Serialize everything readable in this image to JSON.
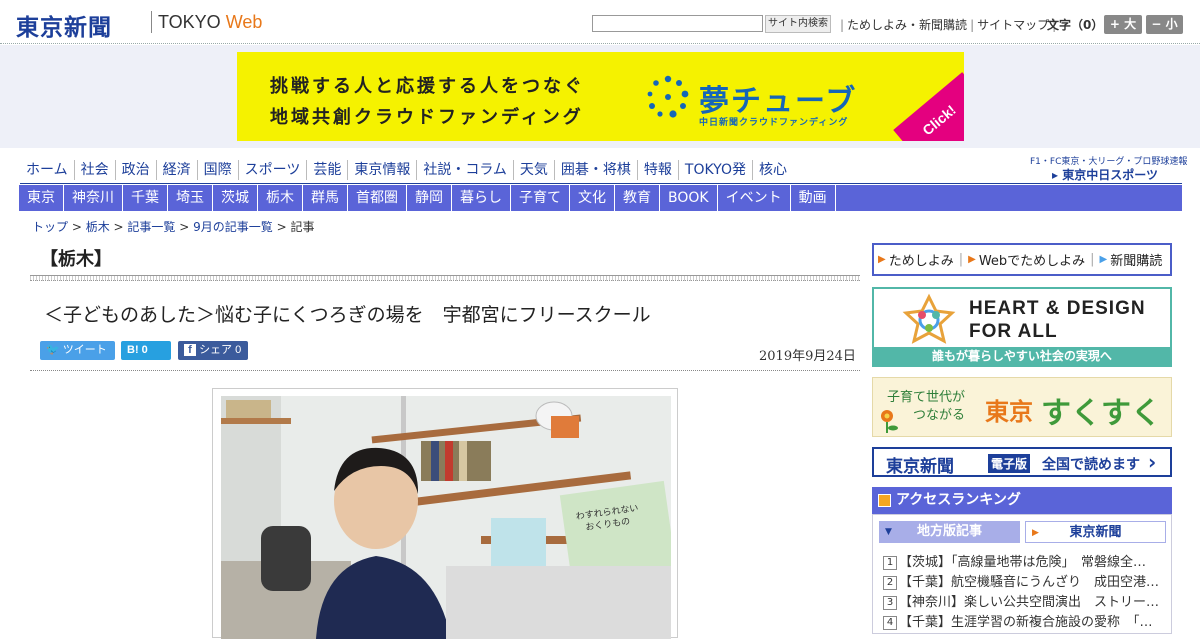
{
  "header": {
    "logo": "東京新聞",
    "logo_web_prefix": "TOKYO",
    "logo_web_suffix": "Web",
    "search_button": "サイト内検索",
    "links": [
      "ためしよみ・新聞購読",
      "サイトマップ"
    ],
    "font_size_label": "文字（0）",
    "bigger_button": "+ 大",
    "smaller_button": "− 小"
  },
  "banner": {
    "line1": "挑戦する人と応援する人をつなぐ",
    "line2": "地域共創クラウドファンディング",
    "brand": "夢チューブ",
    "brand_sub": "中日新聞クラウドファンディング",
    "click": "Click!"
  },
  "nav_primary": [
    "ホーム",
    "社会",
    "政治",
    "経済",
    "国際",
    "スポーツ",
    "芸能",
    "東京情報",
    "社説・コラム",
    "天気",
    "囲碁・将棋",
    "特報",
    "TOKYO発",
    "核心"
  ],
  "chunichi_sports": {
    "sub": "F1・FC東京・大リーグ・プロ野球速報",
    "logo": "東京中日スポーツ"
  },
  "nav_regional": [
    "東京",
    "神奈川",
    "千葉",
    "埼玉",
    "茨城",
    "栃木",
    "群馬",
    "首都圏",
    "静岡",
    "暮らし",
    "子育て",
    "文化",
    "教育",
    "BOOK",
    "イベント",
    "動画"
  ],
  "breadcrumb": [
    "トップ",
    "栃木",
    "記事一覧",
    "9月の記事一覧",
    "記事"
  ],
  "article": {
    "section": "【栃木】",
    "title": "＜子どものあした＞悩む子にくつろぎの場を　宇都宮にフリースクール",
    "date": "2019年9月24日",
    "share_tweet": "ツイート",
    "share_hatena": "B! 0",
    "share_facebook": "シェア 0"
  },
  "sidebar": {
    "links": [
      "ためしよみ",
      "Webでためしよみ",
      "新聞購読"
    ],
    "heart_title_1": "HEART & DESIGN",
    "heart_title_2": "FOR ALL",
    "heart_footer": "誰もが暮らしやすい社会の実現へ",
    "suku_sub1": "子育て世代が",
    "suku_sub2": "つながる",
    "suku_brand": "東京",
    "suku_brand2": "すくすく",
    "denshi_logo": "東京新聞",
    "denshi_badge": "電子版",
    "denshi_text": "全国で読めます",
    "ranking_title": "アクセスランキング",
    "ranking_tab_local": "地方版記事",
    "ranking_tab_tokyo": "東京新聞",
    "ranking": [
      {
        "num": "1",
        "text": "【茨城】「高線量地帯は危険」　常磐線全…"
      },
      {
        "num": "2",
        "text": "【千葉】航空機騒音にうんざり　成田空港…"
      },
      {
        "num": "3",
        "text": "【神奈川】楽しい公共空間演出　ストリー…"
      },
      {
        "num": "4",
        "text": "【千葉】生涯学習の新複合施設の愛称　「…"
      }
    ]
  },
  "colors": {
    "brand_blue": "#1d3f9a",
    "nav_blue": "#5a64d8",
    "banner_yellow": "#f5f200",
    "accent_orange": "#e8781a"
  }
}
